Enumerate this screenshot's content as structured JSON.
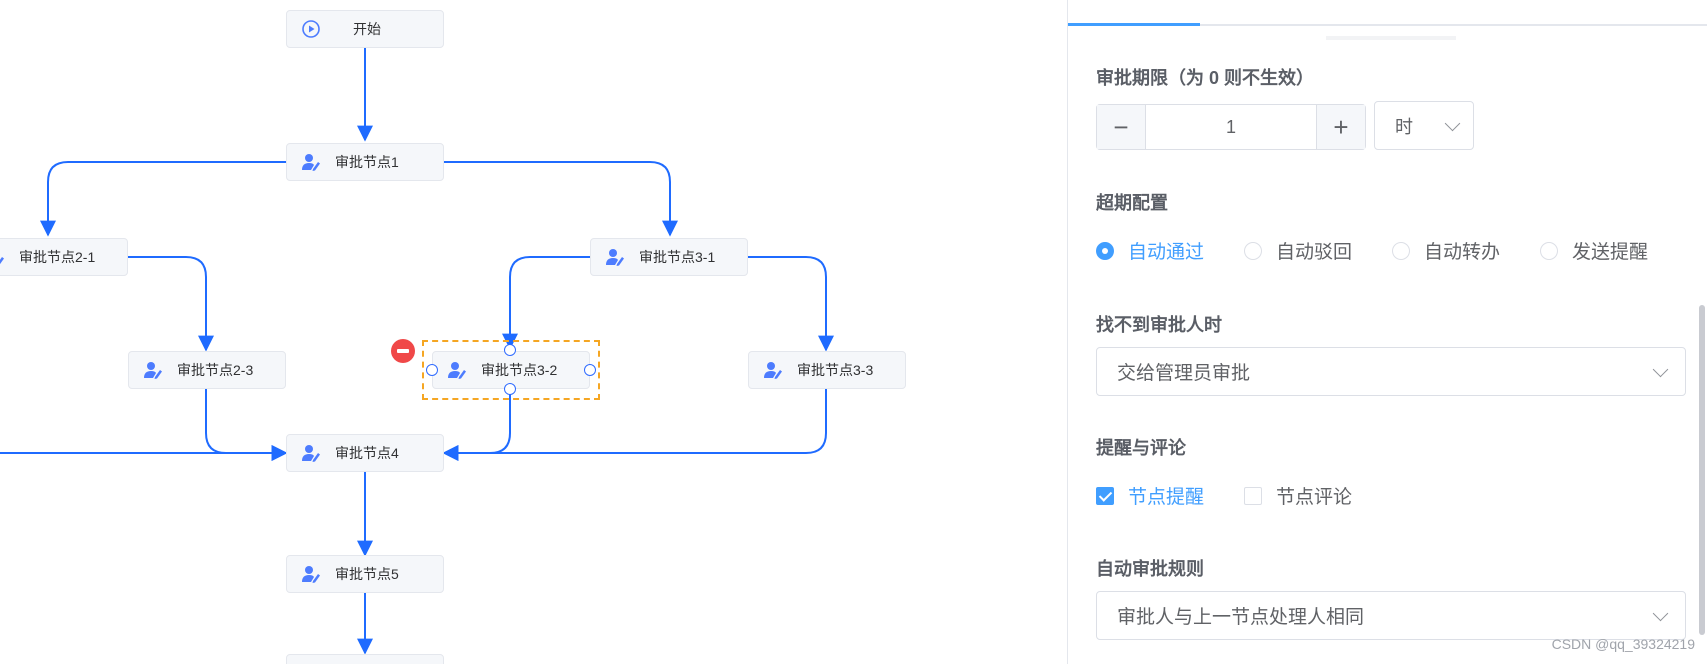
{
  "flow": {
    "start_label": "开始",
    "nodes": {
      "n1": "审批节点1",
      "n21": "审批节点2-1",
      "n23": "审批节点2-3",
      "n31": "审批节点3-1",
      "n32": "审批节点3-2",
      "n33": "审批节点3-3",
      "n4": "审批节点4",
      "n5": "审批节点5"
    }
  },
  "panel": {
    "deadline": {
      "title": "审批期限（为 0 则不生效）",
      "minus": "−",
      "value": "1",
      "plus": "+",
      "unit": "时"
    },
    "overdue": {
      "title": "超期配置",
      "options": [
        "自动通过",
        "自动驳回",
        "自动转办",
        "发送提醒"
      ],
      "selected": "自动通过"
    },
    "no_approver": {
      "title": "找不到审批人时",
      "value": "交给管理员审批"
    },
    "remind": {
      "title": "提醒与评论",
      "options": [
        "节点提醒",
        "节点评论"
      ],
      "checked": [
        "节点提醒"
      ]
    },
    "auto_rule": {
      "title": "自动审批规则",
      "value": "审批人与上一节点处理人相同"
    }
  },
  "watermark": "CSDN @qq_39324219",
  "colors": {
    "accent": "#409eff",
    "edge": "#1f6bff",
    "selection": "#f5a623",
    "delete": "#f04848"
  }
}
